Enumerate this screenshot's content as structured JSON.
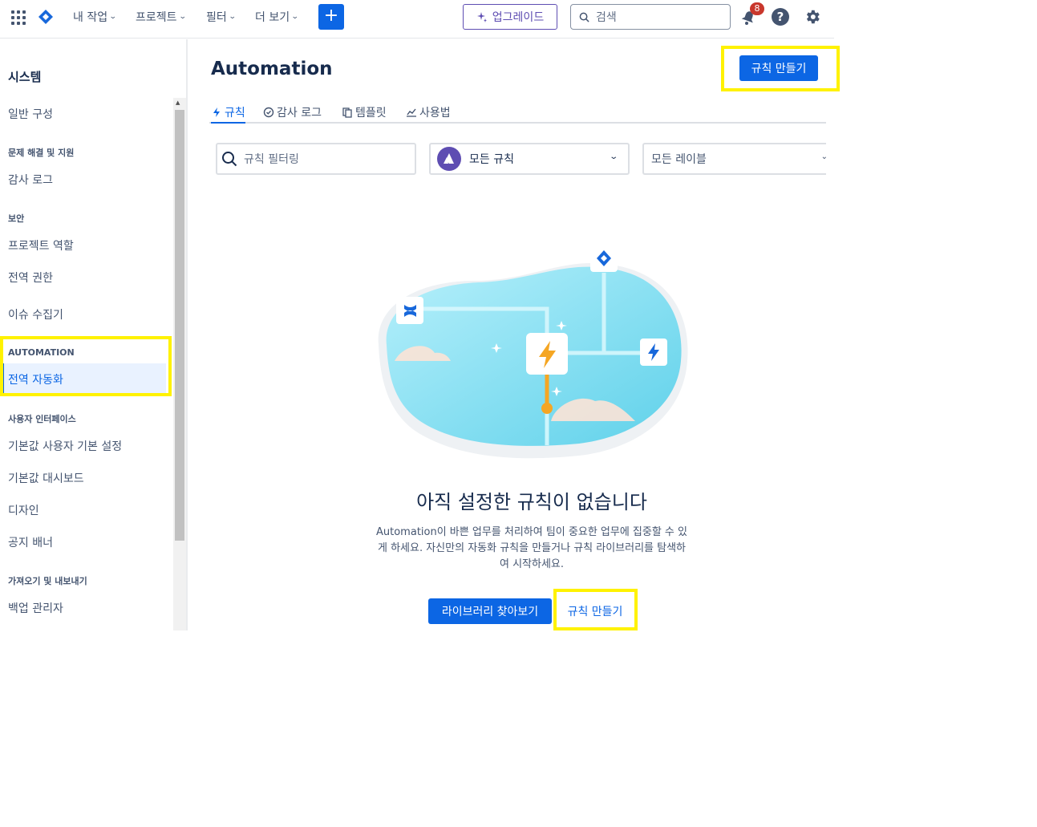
{
  "topnav": {
    "items": [
      {
        "label": "내 작업"
      },
      {
        "label": "프로젝트"
      },
      {
        "label": "필터"
      },
      {
        "label": "더 보기"
      }
    ],
    "create_label": "+",
    "upgrade_label": "업그레이드",
    "search_placeholder": "검색",
    "notification_count": "8",
    "help_label": "?"
  },
  "sidebar": {
    "title": "시스템",
    "general": "일반 구성",
    "section_troubleshoot": "문제 해결 및 지원",
    "audit_log": "감사 로그",
    "section_security": "보안",
    "project_roles": "프로젝트 역할",
    "global_permissions": "전역 권한",
    "issue_collectors": "이슈 수집기",
    "section_automation": "AUTOMATION",
    "global_automation": "전역 자동화",
    "section_ui": "사용자 인터페이스",
    "default_user_prefs": "기본값 사용자 기본 설정",
    "default_dashboard": "기본값 대시보드",
    "design": "디자인",
    "announcement_banner": "공지 배너",
    "section_import_export": "가져오기 및 내보내기",
    "backup_manager": "백업 관리자"
  },
  "main": {
    "title": "Automation",
    "create_rule_label": "규칙 만들기",
    "tabs": [
      {
        "label": "규칙",
        "icon": "bolt-icon"
      },
      {
        "label": "감사 로그",
        "icon": "check-circle-icon"
      },
      {
        "label": "템플릿",
        "icon": "copy-icon"
      },
      {
        "label": "사용법",
        "icon": "chart-icon"
      }
    ],
    "filter_placeholder": "규칙 필터링",
    "scope_select": "모든 규칙",
    "label_select": "모든 레이블",
    "empty_title": "아직 설정한 규칙이 없습니다",
    "empty_desc_1": "Automation이 바쁜 업무를 처리하여 팀이 중요한 업무에 집중할 수 있",
    "empty_desc_2": "게 하세요. 자신만의 자동화 규칙을 만들거나 규칙 라이브러리를 탐색하",
    "empty_desc_3": "여 시작하세요.",
    "browse_library_label": "라이브러리 찾아보기",
    "create_rule_link_label": "규칙 만들기"
  },
  "colors": {
    "accent": "#0c66e4",
    "upgrade": "#5e4db2",
    "highlight": "#fff200",
    "badge": "#c9372c"
  }
}
